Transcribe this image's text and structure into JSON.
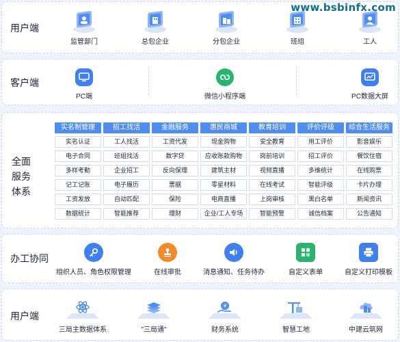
{
  "watermark": "www.bsbinfx.com",
  "user_top": {
    "label": "用户端",
    "items": [
      {
        "label": "监管部门",
        "icon": "supervision-department-icon"
      },
      {
        "label": "总包企业",
        "icon": "general-contractor-icon"
      },
      {
        "label": "分包企业",
        "icon": "subcontractor-icon"
      },
      {
        "label": "班组",
        "icon": "team-icon"
      },
      {
        "label": "工人",
        "icon": "worker-icon"
      }
    ]
  },
  "client": {
    "label": "客户端",
    "items": [
      {
        "label": "PC端",
        "icon": "pc-icon"
      },
      {
        "label": "微信小程序端",
        "icon": "mini-program-icon"
      },
      {
        "label": "PC数据大屏",
        "icon": "data-screen-icon"
      }
    ]
  },
  "services": {
    "label_lines": [
      "全面",
      "服务",
      "体系"
    ],
    "columns": [
      {
        "head": "实名制管理",
        "cells": [
          "实名认证",
          "电子合同",
          "多样考勤",
          "记工记账",
          "工资发放",
          "数据统计"
        ]
      },
      {
        "head": "招工找活",
        "cells": [
          "工人找活",
          "班组找活",
          "企业招工",
          "电子履历",
          "自动匹配",
          "智能推荐"
        ]
      },
      {
        "head": "金融服务",
        "cells": [
          "工资代发",
          "数字贷",
          "反向保理",
          "票据",
          "保险",
          "理财"
        ]
      },
      {
        "head": "惠民商城",
        "cells": [
          "现金购物",
          "应收账款购物",
          "建筑主材",
          "零星材料",
          "电商直播",
          "企业/工人专场"
        ]
      },
      {
        "head": "教育培训",
        "cells": [
          "安全教育",
          "岗前培训",
          "视频直播",
          "在线考试",
          "上岗审核",
          "智能预警"
        ]
      },
      {
        "head": "评价评级",
        "cells": [
          "用工评价",
          "招工评价",
          "多维统计",
          "智能评级",
          "黑白名单",
          "诚信档案"
        ]
      },
      {
        "head": "综合生活服务",
        "cells": [
          "影音娱乐",
          "餐饮住宿",
          "在线购票",
          "卡片办理",
          "新闻资讯",
          "公告通知"
        ]
      }
    ]
  },
  "office": {
    "label": "办工协同",
    "items": [
      {
        "label": "组织人员、角色权限管理",
        "icon": "key-icon",
        "color": "#3f7ff0"
      },
      {
        "label": "在线审批",
        "icon": "stamp-icon",
        "color": "#f08a2a"
      },
      {
        "label": "消息通知、任务待办",
        "icon": "speaker-icon",
        "color": "#3f7ff0"
      },
      {
        "label": "自定义表单",
        "icon": "form-grid-icon",
        "color": "#2ab56f"
      },
      {
        "label": "自定义打印模板",
        "icon": "printer-icon",
        "color": "#3f7ff0"
      }
    ]
  },
  "user_bottom": {
    "label": "用户端",
    "items": [
      {
        "label": "三局主数据体系",
        "icon": "atom-icon"
      },
      {
        "label": "\"三局通\"",
        "icon": "layers-icon"
      },
      {
        "label": "财务系统",
        "icon": "finance-icon"
      },
      {
        "label": "智慧工地",
        "icon": "crane-icon"
      },
      {
        "label": "中建云筑网",
        "icon": "cloud-building-icon"
      }
    ]
  },
  "colors": {
    "accent": "#4f8ef0",
    "icon_blue": "#3f7ff0",
    "icon_orange": "#f08a2a",
    "icon_green": "#2ab56f",
    "mini_program": "#2ab56f"
  }
}
